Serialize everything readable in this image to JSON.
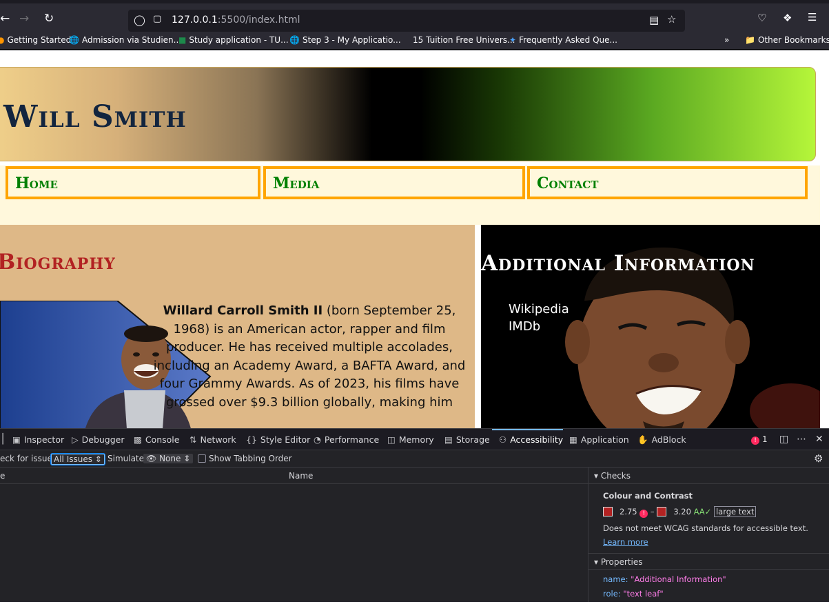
{
  "browser": {
    "url_host": "127.0.0.1",
    "url_rest": ":5500/index.html",
    "bookmarks": [
      {
        "label": "Getting Started"
      },
      {
        "label": "Admission via Studien..."
      },
      {
        "label": "Study application - TU..."
      },
      {
        "label": "Step 3 - My Applicatio..."
      },
      {
        "label": "15 Tuition Free Univers..."
      },
      {
        "label": "Frequently Asked Que..."
      }
    ],
    "other_bookmarks": "Other Bookmarks"
  },
  "page": {
    "site_title": "Will Smith",
    "nav": [
      "Home",
      "Media",
      "Contact"
    ],
    "bio": {
      "title": "Biography",
      "name_bold": "Willard Carroll Smith II",
      "text": " (born September 25, 1968) is an American actor, rapper and film producer. He has received multiple accolades, including an Academy Award, a BAFTA Award, and four Grammy Awards. As of 2023, his films have grossed over $9.3 billion globally, making him"
    },
    "additional": {
      "title": "Additional Information",
      "links": [
        "Wikipedia",
        "IMDb"
      ]
    }
  },
  "devtools": {
    "tabs": [
      "Inspector",
      "Debugger",
      "Console",
      "Network",
      "Style Editor",
      "Performance",
      "Memory",
      "Storage",
      "Accessibility",
      "Application",
      "AdBlock"
    ],
    "active_tab": "Accessibility",
    "error_count": "1",
    "check_label": "eck for issues:",
    "check_value": "All Issues",
    "simulate_label": "Simulate:",
    "simulate_value": "None",
    "tabbing_label": "Show Tabbing Order",
    "col_left": "e",
    "col_name": "Name",
    "checks_header": "Checks",
    "contrast_title": "Colour and Contrast",
    "contrast_low": "2.75",
    "contrast_high": "3.20",
    "contrast_aa": "AA✓",
    "contrast_tag": "large text",
    "contrast_msg": "Does not meet WCAG standards for accessible text.",
    "learn_more": "Learn more",
    "properties_header": "Properties",
    "prop_name_key": "name:",
    "prop_name_val": "\"Additional Information\"",
    "prop_role_key": "role:",
    "prop_role_val": "\"text leaf\""
  },
  "colors": {
    "bio_bg": "#deb887",
    "bio_title": "#b22222",
    "nav_border": "#ffa500",
    "nav_text": "#008000",
    "nav_bg": "#fff8dc"
  }
}
